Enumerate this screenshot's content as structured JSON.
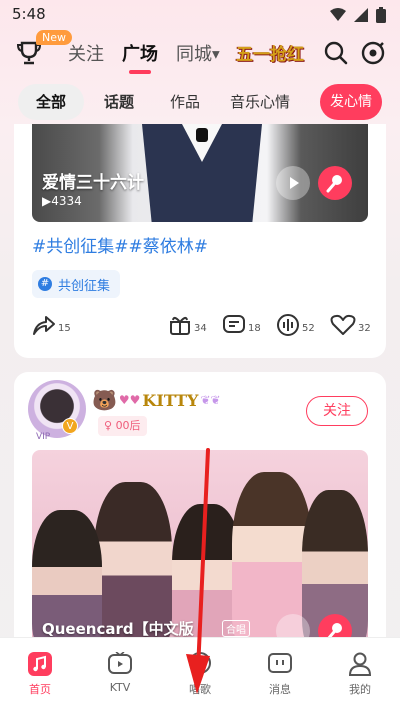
{
  "status_bar": {
    "time": "5:48"
  },
  "top_nav": {
    "new_badge": "New",
    "tabs": [
      {
        "label": "关注"
      },
      {
        "label": "广场"
      },
      {
        "label": "同城"
      }
    ],
    "active_tab": "广场",
    "promo_logo_text": "五一抢红"
  },
  "sub_tabs": {
    "items": [
      {
        "label": "全部"
      },
      {
        "label": "话题"
      },
      {
        "label": "作品"
      },
      {
        "label": "音乐心情"
      }
    ],
    "post_button": "发心情"
  },
  "feed": {
    "post1": {
      "song_title": "爱情三十六计",
      "plays": "▶4334",
      "hashtags": "#共创征集##蔡依林#",
      "topic_chip": "共创征集",
      "actions": {
        "share": "15",
        "gift": "34",
        "comment": "18",
        "chorus": "52",
        "like": "32"
      }
    },
    "post2": {
      "username": "KITTY",
      "age_tag": "00后",
      "follow_button": "关注",
      "song_title": "Queencard【中文版",
      "duet_tag": "合唱"
    }
  },
  "bottom_nav": {
    "items": [
      {
        "label": "首页"
      },
      {
        "label": "KTV"
      },
      {
        "label": "唱歌"
      },
      {
        "label": "消息"
      },
      {
        "label": "我的"
      }
    ]
  },
  "colors": {
    "accent": "#ff3d5e",
    "hashtag": "#2f7de1",
    "new_badge": "#ff9b3d"
  }
}
